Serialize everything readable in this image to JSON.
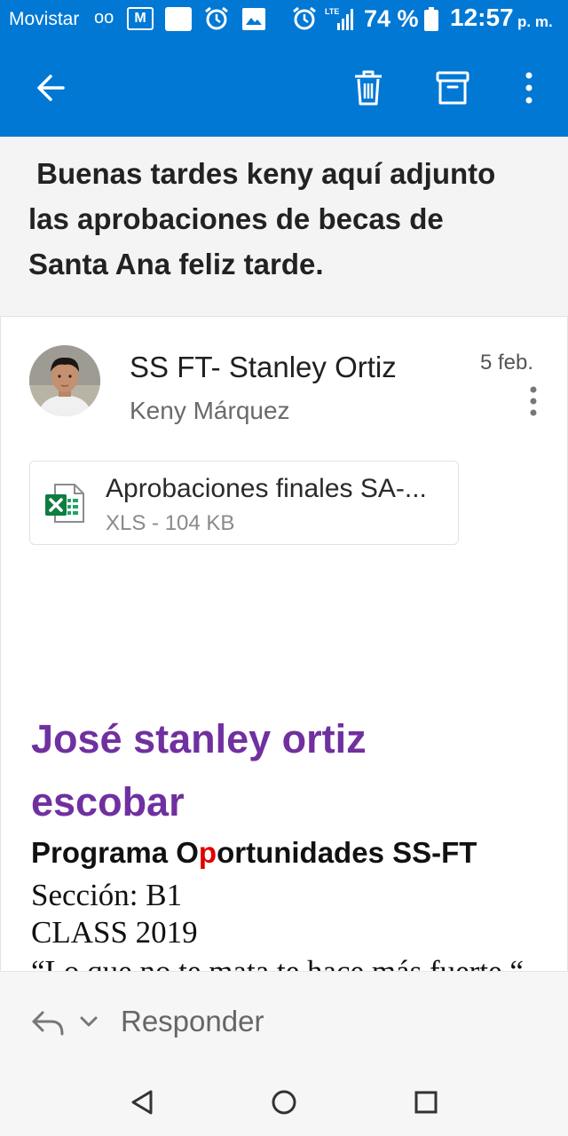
{
  "status_bar": {
    "carrier": "Movistar",
    "voicemail_icon": "oo",
    "battery_percent": "74 %",
    "time": "12:57",
    "ampm": "p. m."
  },
  "app_bar": {
    "back_icon": "arrow-left",
    "delete_icon": "trash",
    "archive_icon": "archive",
    "more_icon": "vertical-dots"
  },
  "subject": " Buenas tardes keny aquí adjunto las aprobaciones de becas de Santa Ana feliz tarde.",
  "message": {
    "sender": "SS FT- Stanley Ortiz",
    "recipient": "Keny Márquez",
    "date": "5 feb.",
    "attachment": {
      "name": "Aprobaciones finales SA-...",
      "meta": "XLS - 104 KB",
      "icon": "excel-file-icon"
    },
    "signature": {
      "name": "José stanley ortiz escobar",
      "program_prefix": "Programa O",
      "program_accent": "p",
      "program_suffix": "ortunidades  SS-FT",
      "section": "Sección: B1",
      "class": "CLASS 2019",
      "quote": "“Lo que no te mata te hace más fuerte.“"
    }
  },
  "reply_bar": {
    "label": "Responder"
  },
  "colors": {
    "accent": "#0078d4",
    "signature_name": "#7030a0",
    "program_accent": "#e00000"
  }
}
